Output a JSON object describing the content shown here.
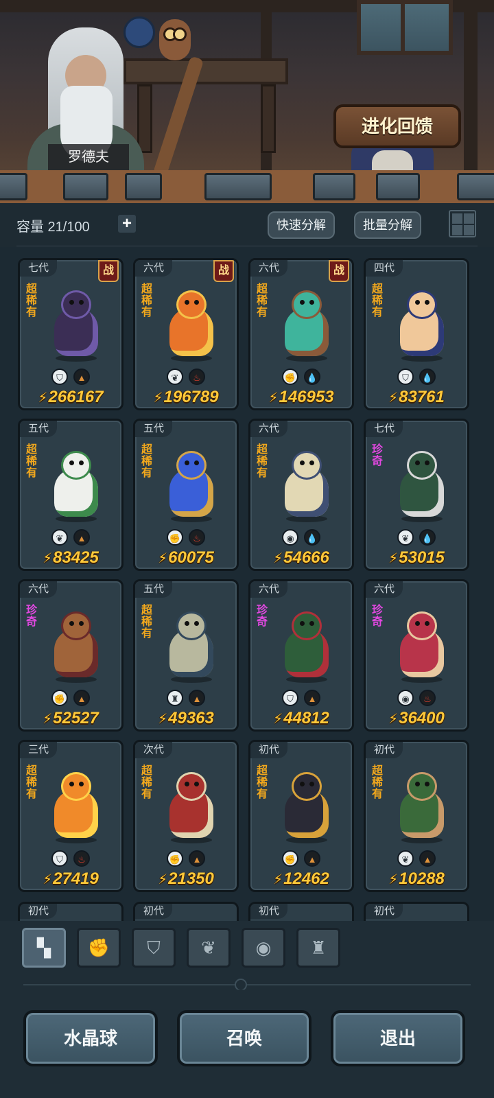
{
  "banner": {
    "npc_name": "罗德夫",
    "evolution_button": "进化回馈"
  },
  "toolbar": {
    "capacity_label": "容量 21/100",
    "add_icon": "plus-icon",
    "quick_decompose": "快速分解",
    "batch_decompose": "批量分解",
    "view_toggle_icon": "grid-icon"
  },
  "cards": [
    {
      "gen": "七代",
      "battle": "战",
      "rarity": "超稀有",
      "rarity_class": "ssr",
      "types": [
        "shield-icon",
        "earth-icon"
      ],
      "power": "266167",
      "color": "#3b2e55",
      "accent": "#6f5aa8"
    },
    {
      "gen": "六代",
      "battle": "战",
      "rarity": "超稀有",
      "rarity_class": "ssr",
      "types": [
        "leaf-icon",
        "fire-icon"
      ],
      "power": "196789",
      "color": "#e8742a",
      "accent": "#f4c24a"
    },
    {
      "gen": "六代",
      "battle": "战",
      "rarity": "超稀有",
      "rarity_class": "ssr",
      "types": [
        "fist-icon",
        "water-icon"
      ],
      "power": "146953",
      "color": "#3fb49c",
      "accent": "#8a5a3a"
    },
    {
      "gen": "四代",
      "battle": "",
      "rarity": "超稀有",
      "rarity_class": "ssr",
      "types": [
        "shield-icon",
        "water-icon"
      ],
      "power": "83761",
      "color": "#f0c89a",
      "accent": "#2d3a78"
    },
    {
      "gen": "五代",
      "battle": "",
      "rarity": "超稀有",
      "rarity_class": "ssr",
      "types": [
        "leaf-icon",
        "earth-icon"
      ],
      "power": "83425",
      "color": "#eef0ec",
      "accent": "#3d8a4c"
    },
    {
      "gen": "五代",
      "battle": "",
      "rarity": "超稀有",
      "rarity_class": "ssr",
      "types": [
        "fist-icon",
        "fire-icon"
      ],
      "power": "60075",
      "color": "#3a5fd8",
      "accent": "#d4a548"
    },
    {
      "gen": "六代",
      "battle": "",
      "rarity": "超稀有",
      "rarity_class": "ssr",
      "types": [
        "spirit-icon",
        "water-icon"
      ],
      "power": "54666",
      "color": "#e2d8b4",
      "accent": "#3f4f73"
    },
    {
      "gen": "七代",
      "battle": "",
      "rarity": "珍奇",
      "rarity_class": "sr",
      "types": [
        "leaf-icon",
        "water-icon"
      ],
      "power": "53015",
      "color": "#2f5540",
      "accent": "#d8d8d8"
    },
    {
      "gen": "六代",
      "battle": "",
      "rarity": "珍奇",
      "rarity_class": "sr",
      "types": [
        "fist-icon",
        "earth-icon"
      ],
      "power": "52527",
      "color": "#a0643a",
      "accent": "#6a2a2a"
    },
    {
      "gen": "五代",
      "battle": "",
      "rarity": "超稀有",
      "rarity_class": "ssr",
      "types": [
        "tower-icon",
        "earth-icon"
      ],
      "power": "49363",
      "color": "#b8b89e",
      "accent": "#33495c"
    },
    {
      "gen": "六代",
      "battle": "",
      "rarity": "珍奇",
      "rarity_class": "sr",
      "types": [
        "shield-icon",
        "earth-icon"
      ],
      "power": "44812",
      "color": "#2e5e3a",
      "accent": "#b0303a"
    },
    {
      "gen": "六代",
      "battle": "",
      "rarity": "珍奇",
      "rarity_class": "sr",
      "types": [
        "spirit-icon",
        "fire-icon"
      ],
      "power": "36400",
      "color": "#b8344a",
      "accent": "#e8c8a0"
    },
    {
      "gen": "三代",
      "battle": "",
      "rarity": "超稀有",
      "rarity_class": "ssr",
      "types": [
        "shield-icon",
        "fire-icon"
      ],
      "power": "27419",
      "color": "#f08a2a",
      "accent": "#ffd24a"
    },
    {
      "gen": "次代",
      "battle": "",
      "rarity": "超稀有",
      "rarity_class": "ssr",
      "types": [
        "fist-icon",
        "earth-icon"
      ],
      "power": "21350",
      "color": "#a8322e",
      "accent": "#e0d4b0"
    },
    {
      "gen": "初代",
      "battle": "",
      "rarity": "超稀有",
      "rarity_class": "ssr",
      "types": [
        "fist-icon",
        "earth-icon"
      ],
      "power": "12462",
      "color": "#2a2a36",
      "accent": "#d8a23a"
    },
    {
      "gen": "初代",
      "battle": "",
      "rarity": "超稀有",
      "rarity_class": "ssr",
      "types": [
        "leaf-icon",
        "earth-icon"
      ],
      "power": "10288",
      "color": "#3a6a3a",
      "accent": "#c89a6a"
    }
  ],
  "partial_cards": [
    "初代",
    "初代",
    "初代",
    "初代"
  ],
  "filters": [
    {
      "icon": "all-categories-icon",
      "glyph": "▚",
      "active": true
    },
    {
      "icon": "fist-icon",
      "glyph": "✊",
      "active": false
    },
    {
      "icon": "shield-icon",
      "glyph": "⛉",
      "active": false
    },
    {
      "icon": "leaf-icon",
      "glyph": "❦",
      "active": false
    },
    {
      "icon": "spirit-icon",
      "glyph": "◉",
      "active": false
    },
    {
      "icon": "tower-icon",
      "glyph": "♜",
      "active": false
    }
  ],
  "bottom": {
    "crystal_ball": "水晶球",
    "summon": "召唤",
    "exit": "退出"
  },
  "colors": {
    "power_gold": "#ffc93a",
    "super_rare": "#f2a81d",
    "rare": "#e148e0",
    "card_bg": "#2d3e48",
    "page_bg": "#1c2a33"
  }
}
